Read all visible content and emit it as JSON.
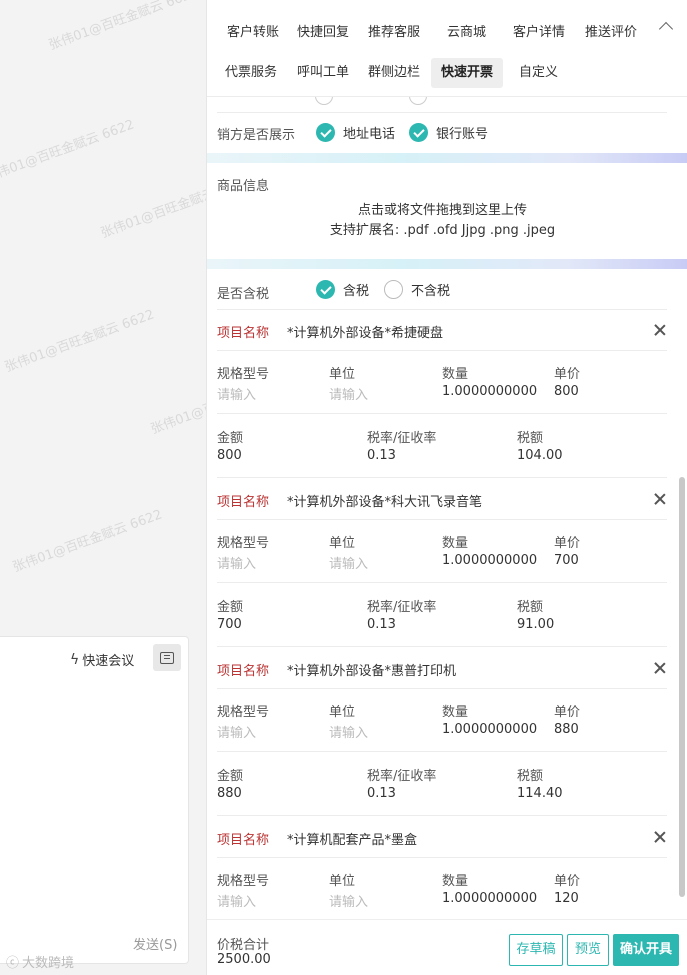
{
  "watermark": "张伟01@百旺金赋云 6622",
  "chat": {
    "quick_meeting": "快速会议",
    "send": "发送(S)",
    "brand": "大数跨境"
  },
  "tabs": {
    "row1": [
      "客户转账",
      "快捷回复",
      "推荐客服",
      "云商城",
      "客户详情",
      "推送评价"
    ],
    "row2": [
      "代票服务",
      "呼叫工单",
      "群侧边栏",
      "快速开票",
      "自定义"
    ],
    "active": "快速开票"
  },
  "seller_display": {
    "label": "销方是否展示",
    "options": [
      {
        "label": "地址电话",
        "checked": true
      },
      {
        "label": "银行账号",
        "checked": true
      }
    ]
  },
  "goods": {
    "label": "商品信息",
    "upload_line1": "点击或将文件拖拽到这里上传",
    "upload_line2": "支持扩展名: .pdf .ofd Jjpg .png .jpeg"
  },
  "tax_included": {
    "label": "是否含税",
    "yes": "含税",
    "no": "不含税",
    "selected": "含税"
  },
  "field_labels": {
    "item_name": "项目名称",
    "spec": "规格型号",
    "unit": "单位",
    "qty": "数量",
    "price": "单价",
    "amount": "金额",
    "rate": "税率/征收率",
    "tax": "税额",
    "placeholder": "请输入"
  },
  "items": [
    {
      "name": "*计算机外部设备*希捷硬盘",
      "qty": "1.0000000000",
      "price": "800",
      "amount": "800",
      "rate": "0.13",
      "tax": "104.00"
    },
    {
      "name": "*计算机外部设备*科大讯飞录音笔",
      "qty": "1.0000000000",
      "price": "700",
      "amount": "700",
      "rate": "0.13",
      "tax": "91.00"
    },
    {
      "name": "*计算机外部设备*惠普打印机",
      "qty": "1.0000000000",
      "price": "880",
      "amount": "880",
      "rate": "0.13",
      "tax": "114.40"
    },
    {
      "name": "*计算机配套产品*墨盒",
      "qty": "1.0000000000",
      "price": "120"
    }
  ],
  "footer": {
    "total_label": "价税合计",
    "total_value": "2500.00",
    "save_draft": "存草稿",
    "preview": "预览",
    "confirm": "确认开具"
  },
  "colors": {
    "accent": "#2db7b1"
  }
}
